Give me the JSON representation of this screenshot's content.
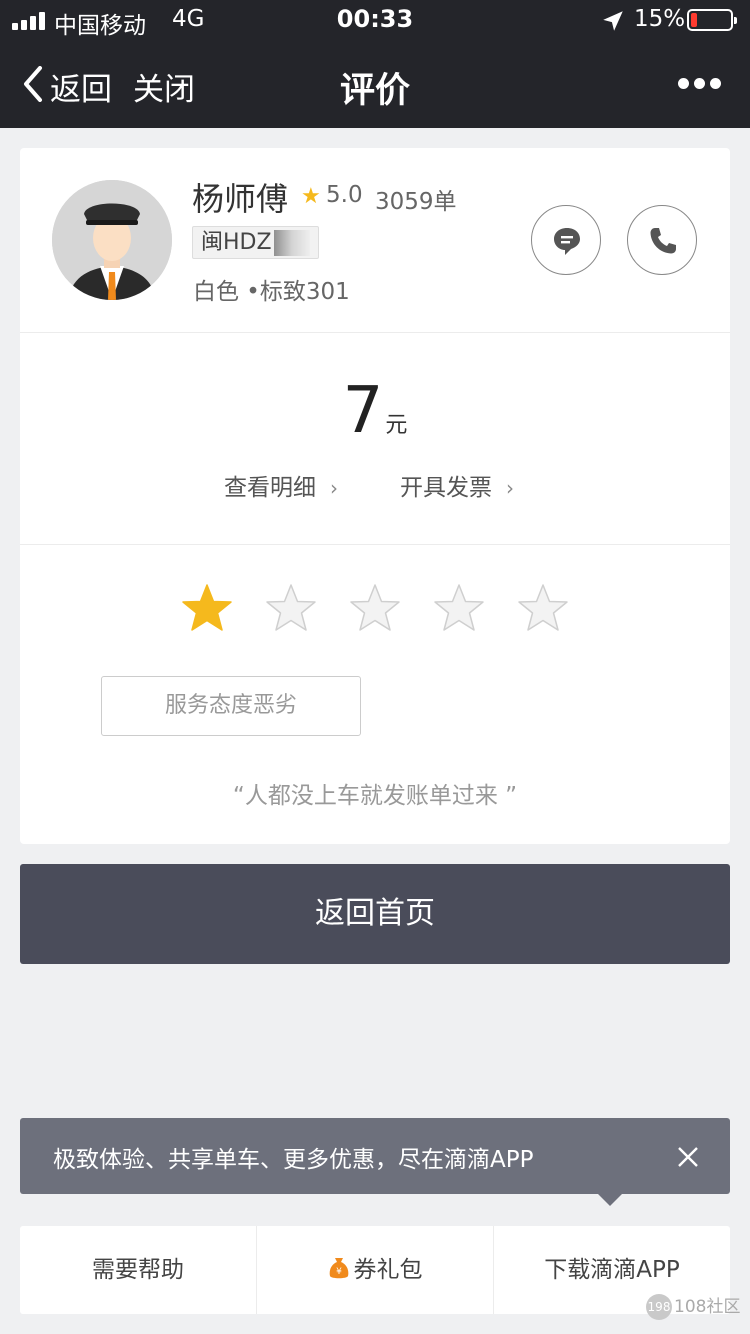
{
  "status_bar": {
    "carrier": "中国移动",
    "network": "4G",
    "time": "00:33",
    "battery": "15%",
    "battery_level": 0.15
  },
  "nav": {
    "back_label": "返回",
    "close_label": "关闭",
    "title": "评价"
  },
  "driver": {
    "name": "杨师傅",
    "rating": "5.0",
    "orders": "3059单",
    "plate": "闽HDZ",
    "car": "白色 •标致301"
  },
  "fare": {
    "amount": "7",
    "unit": "元",
    "detail_link": "查看明细",
    "invoice_link": "开具发票"
  },
  "review": {
    "star_rating": 1,
    "star_max": 5,
    "tag": "服务态度恶劣",
    "comment": "“人都没上车就发账单过来 ”"
  },
  "home_button": "返回首页",
  "promo": {
    "text": "极致体验、共享单车、更多优惠，尽在滴滴APP"
  },
  "bottom_bar": {
    "help": "需要帮助",
    "coupon": "券礼包",
    "download": "下载滴滴APP"
  },
  "watermark": {
    "logo": "198",
    "text": "108社区"
  },
  "colors": {
    "topbar": "#24252a",
    "star_active": "#f5b91d",
    "star_inactive": "#e6e6e6",
    "home_button": "#4a4c5a",
    "promo": "#6d707c",
    "battery_low": "#ff3b30"
  }
}
